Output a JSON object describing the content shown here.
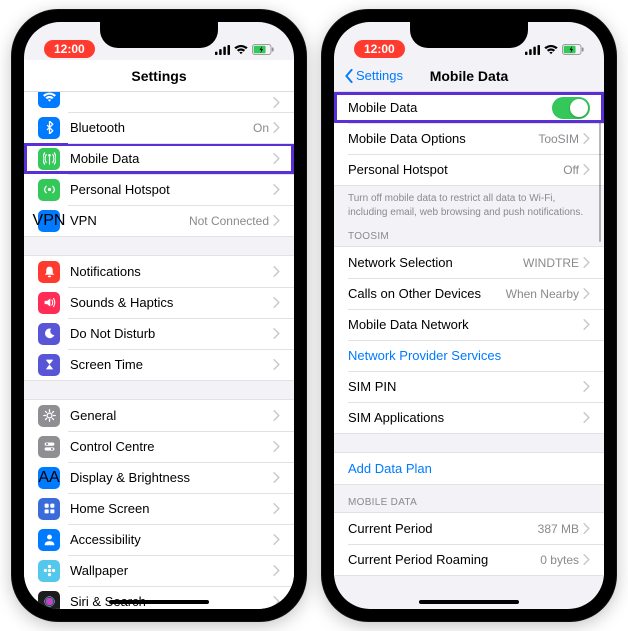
{
  "status": {
    "time": "12:00"
  },
  "left": {
    "title": "Settings",
    "rows": [
      {
        "icon": "wifi",
        "color": "#007aff",
        "label": "",
        "value": ""
      },
      {
        "icon": "bluetooth",
        "color": "#007aff",
        "label": "Bluetooth",
        "value": "On"
      },
      {
        "icon": "antenna",
        "color": "#34c759",
        "label": "Mobile Data",
        "value": "",
        "highlight": true
      },
      {
        "icon": "hotspot",
        "color": "#34c759",
        "label": "Personal Hotspot",
        "value": ""
      },
      {
        "icon": "vpn",
        "color": "#007aff",
        "label": "VPN",
        "value": "Not Connected"
      }
    ],
    "rows2": [
      {
        "icon": "bell",
        "color": "#ff3b30",
        "label": "Notifications"
      },
      {
        "icon": "speaker",
        "color": "#ff2d55",
        "label": "Sounds & Haptics"
      },
      {
        "icon": "moon",
        "color": "#5856d6",
        "label": "Do Not Disturb"
      },
      {
        "icon": "hourglass",
        "color": "#5856d6",
        "label": "Screen Time"
      }
    ],
    "rows3": [
      {
        "icon": "gear",
        "color": "#8e8e93",
        "label": "General"
      },
      {
        "icon": "toggles",
        "color": "#8e8e93",
        "label": "Control Centre"
      },
      {
        "icon": "aa",
        "color": "#007aff",
        "label": "Display & Brightness"
      },
      {
        "icon": "grid",
        "color": "#3a6bdb",
        "label": "Home Screen"
      },
      {
        "icon": "person",
        "color": "#007aff",
        "label": "Accessibility"
      },
      {
        "icon": "flower",
        "color": "#54c7ec",
        "label": "Wallpaper"
      },
      {
        "icon": "siri",
        "color": "#1c1c1e",
        "label": "Siri & Search"
      }
    ]
  },
  "right": {
    "back": "Settings",
    "title": "Mobile Data",
    "g1": [
      {
        "label": "Mobile Data",
        "toggle": true,
        "highlight": true
      },
      {
        "label": "Mobile Data Options",
        "value": "TooSIM"
      },
      {
        "label": "Personal Hotspot",
        "value": "Off"
      }
    ],
    "g1_footer": "Turn off mobile data to restrict all data to Wi-Fi, including email, web browsing and push notifications.",
    "g2_header": "TOOSIM",
    "g2": [
      {
        "label": "Network Selection",
        "value": "WINDTRE"
      },
      {
        "label": "Calls on Other Devices",
        "value": "When Nearby"
      },
      {
        "label": "Mobile Data Network",
        "value": ""
      },
      {
        "label": "Network Provider Services",
        "link": true
      },
      {
        "label": "SIM PIN",
        "value": ""
      },
      {
        "label": "SIM Applications",
        "value": ""
      }
    ],
    "g3": [
      {
        "label": "Add Data Plan",
        "link": true
      }
    ],
    "g4_header": "MOBILE DATA",
    "g4": [
      {
        "label": "Current Period",
        "value": "387 MB"
      },
      {
        "label": "Current Period Roaming",
        "value": "0 bytes"
      }
    ]
  }
}
